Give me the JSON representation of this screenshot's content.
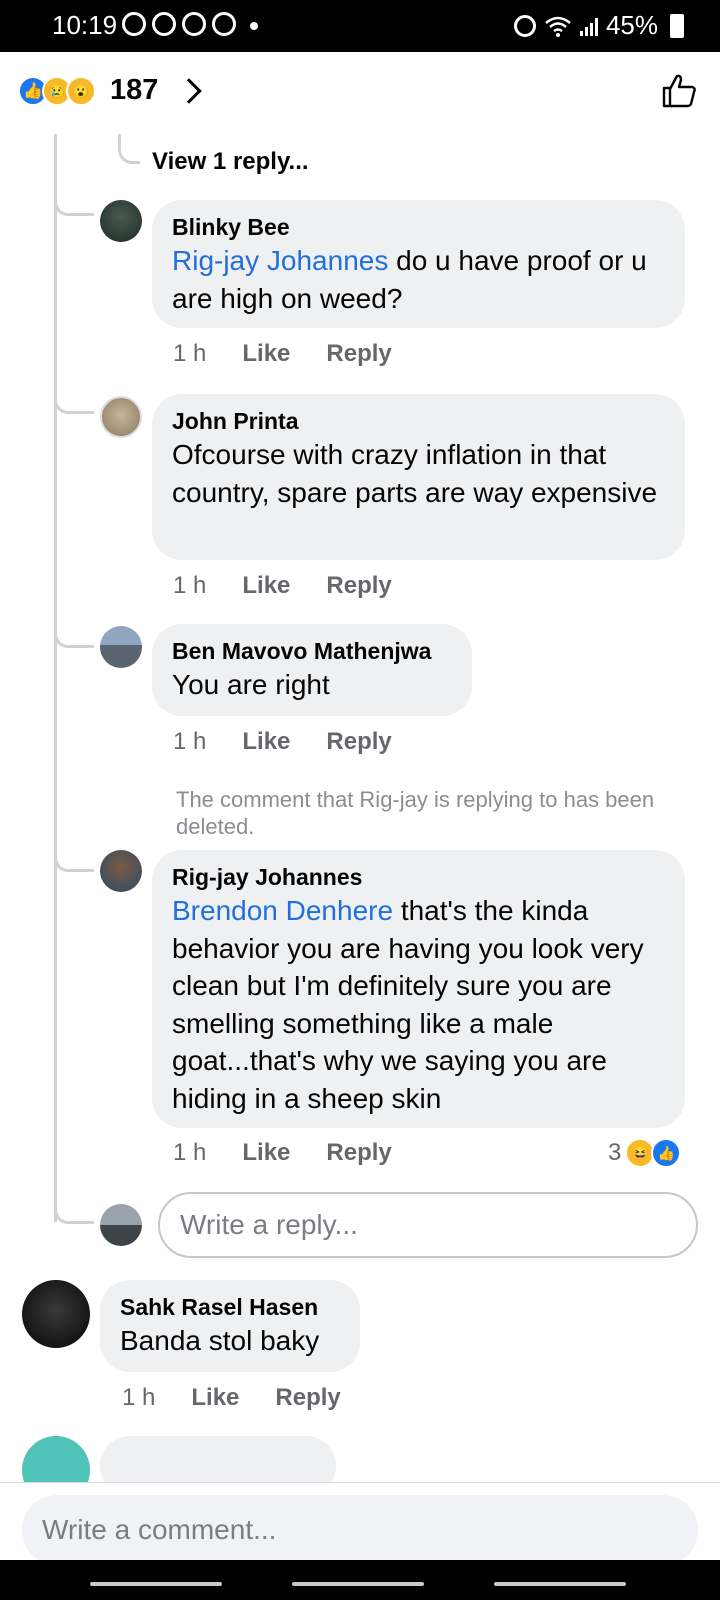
{
  "status_bar": {
    "time": "10:19",
    "battery": "45%"
  },
  "header": {
    "reaction_count": "187",
    "reaction_icons": [
      "like-icon",
      "sad-icon",
      "wow-icon"
    ]
  },
  "thread": {
    "view_replies_label": "View 1 reply...",
    "replies": [
      {
        "author": "Blinky Bee",
        "mention": "Rig-jay Johannes",
        "text": " do u have proof or u are high on weed?",
        "time": "1 h",
        "like_label": "Like",
        "reply_label": "Reply"
      },
      {
        "author": "John Printa",
        "mention": "",
        "text": "Ofcourse with crazy inflation in that country, spare parts are way expensive",
        "time": "1 h",
        "like_label": "Like",
        "reply_label": "Reply"
      },
      {
        "author": "Ben Mavovo Mathenjwa",
        "mention": "",
        "text": "You are right",
        "time": "1 h",
        "like_label": "Like",
        "reply_label": "Reply"
      },
      {
        "deleted_note": "The comment that Rig-jay is replying to has been deleted.",
        "author": "Rig-jay Johannes",
        "mention": "Brendon Denhere",
        "text": " that's the kinda behavior you are having you look very clean but I'm definitely sure you are smelling something like a  male goat...that's why we saying you are hiding in a sheep skin",
        "time": "1 h",
        "like_label": "Like",
        "reply_label": "Reply",
        "reaction_count": "3"
      }
    ],
    "reply_placeholder": "Write a reply..."
  },
  "comment": {
    "author": "Sahk Rasel Hasen",
    "text": "Banda stol baky",
    "time": "1 h",
    "like_label": "Like",
    "reply_label": "Reply"
  },
  "composer": {
    "placeholder": "Write a comment..."
  },
  "colors": {
    "accent": "#1877f2",
    "mention": "#216fdb",
    "bubble": "#eff0f2",
    "meta": "#65676b"
  }
}
